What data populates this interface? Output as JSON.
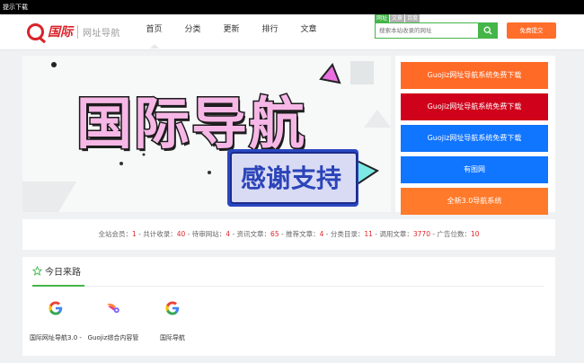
{
  "topbar": {
    "text": "提示下载"
  },
  "logo": {
    "main": "国际",
    "sub": "网址导航"
  },
  "nav": {
    "items": [
      {
        "label": "首页",
        "active": true
      },
      {
        "label": "分类"
      },
      {
        "label": "更新"
      },
      {
        "label": "排行"
      },
      {
        "label": "文章"
      }
    ]
  },
  "search": {
    "tabs": [
      "网址",
      "文章",
      "百度"
    ],
    "placeholder": "搜索本站收录的网址",
    "submit_label": "免费提交"
  },
  "banner": {
    "title": "国际导航",
    "subtitle": "感谢支持"
  },
  "sidebar": {
    "buttons": [
      {
        "label": "Guojiz网址导航系统免费下载",
        "color": "#ff6a26"
      },
      {
        "label": "Guojiz网址导航系统免费下载",
        "color": "#d0021b"
      },
      {
        "label": "Guojiz网址导航系统免费下载",
        "color": "#1075ff"
      },
      {
        "label": "有图网",
        "color": "#1075ff"
      },
      {
        "label": "全新3.0导航系统",
        "color": "#ff7a2a"
      }
    ]
  },
  "stats": {
    "members_label": "全站会员：",
    "members": "1",
    "total_label": "共计收录：",
    "total": "40",
    "pending_label": "待审网站：",
    "pending": "4",
    "articles_label": "资讯文章：",
    "articles": "65",
    "recommend_label": "推荐文章：",
    "recommend": "4",
    "categories_label": "分类目录：",
    "categories": "11",
    "calls_label": "调用文章：",
    "calls": "3770",
    "ads_label": "广告位数：",
    "ads": "10"
  },
  "today": {
    "title": "今日来路",
    "sites": [
      {
        "name": "国际网址导航3.0 -",
        "icon": "google-icon"
      },
      {
        "name": "Guojiz综合内容管",
        "icon": "bird-logo-icon"
      },
      {
        "name": "国际导航",
        "icon": "google-icon"
      }
    ]
  }
}
